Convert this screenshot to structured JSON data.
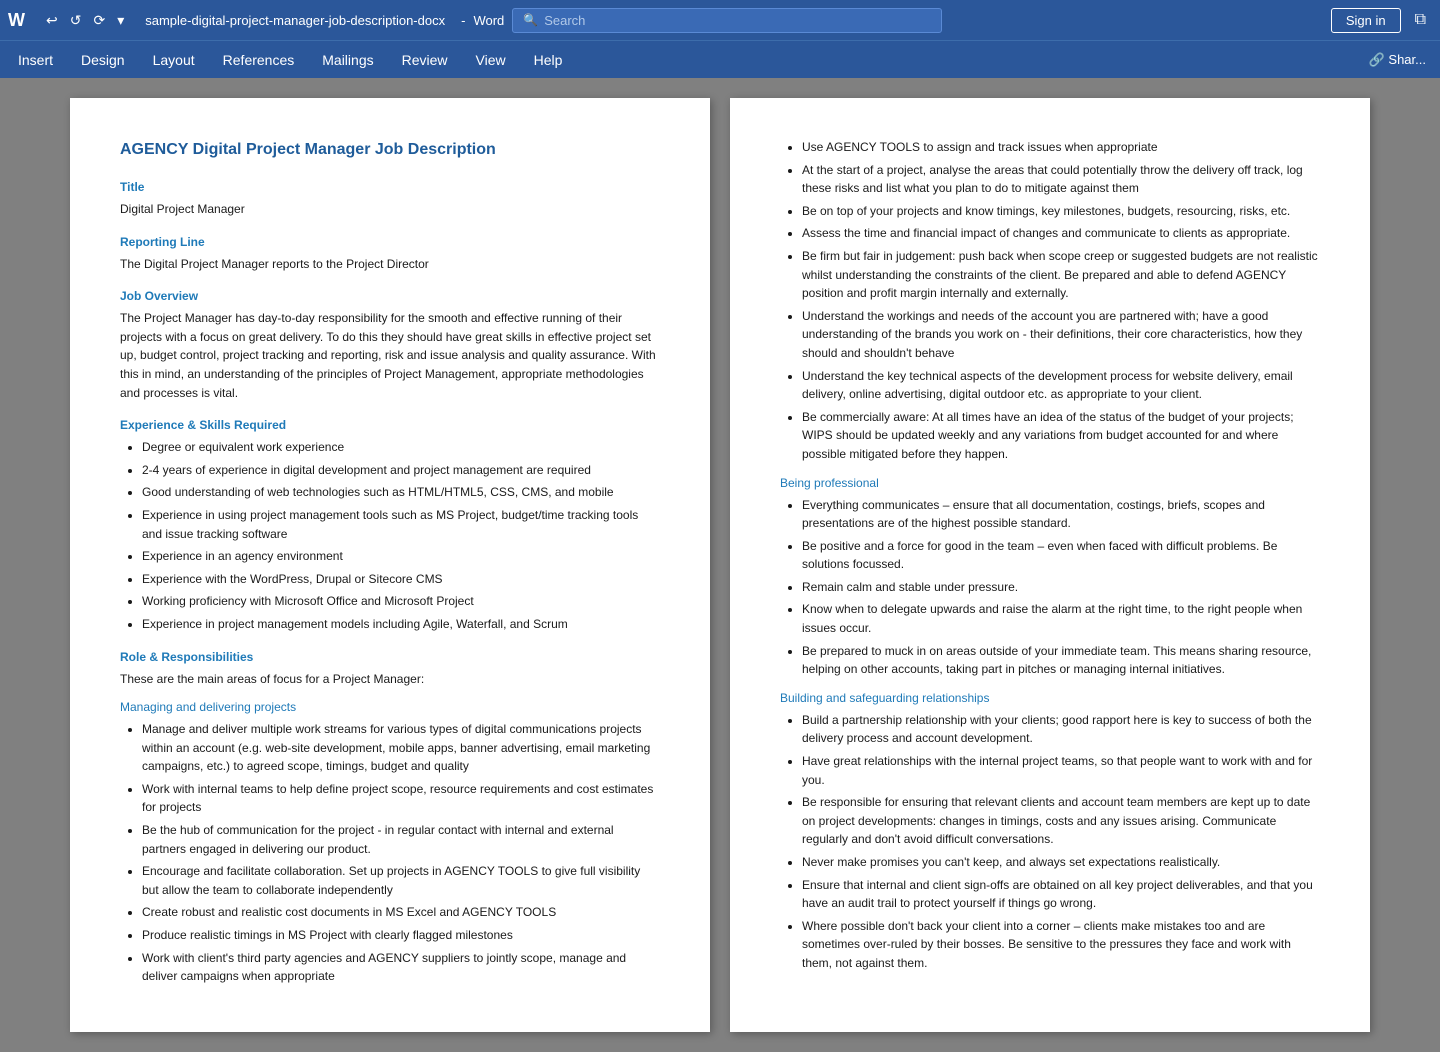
{
  "titlebar": {
    "filename": "sample-digital-project-manager-job-description-docx",
    "separator": " - ",
    "app_name": "Word",
    "search_placeholder": "Search",
    "signin_label": "Sign in",
    "undo_icon": "↩",
    "redo_icon": "↺",
    "autosave_icon": "⟳",
    "quick_access_icon": "▾",
    "restore_icon": "⧉"
  },
  "menubar": {
    "items": [
      "Insert",
      "Design",
      "Layout",
      "References",
      "Mailings",
      "Review",
      "View",
      "Help"
    ],
    "share_label": "🔗 Shar..."
  },
  "page_left": {
    "doc_title": "AGENCY Digital Project Manager Job Description",
    "sections": [
      {
        "heading": "Title",
        "body": "Digital Project Manager"
      },
      {
        "heading": "Reporting Line",
        "body": "The Digital Project Manager reports to the Project Director"
      },
      {
        "heading": "Job Overview",
        "body": "The Project Manager has day-to-day responsibility for the smooth and effective running of their projects with a focus on great delivery. To do this they should have great skills in effective project set up, budget control, project tracking and reporting, risk and issue analysis and quality assurance. With this in mind, an understanding of the principles of Project Management, appropriate methodologies and processes is vital."
      },
      {
        "heading": "Experience & Skills Required",
        "list": [
          "Degree or equivalent work experience",
          "2-4 years of experience in digital development and project management are required",
          "Good understanding of web technologies such as HTML/HTML5, CSS, CMS, and mobile",
          "Experience in using project management tools such as MS Project, budget/time tracking tools and issue tracking software",
          "Experience in an agency environment",
          "Experience with the WordPress, Drupal or Sitecore CMS",
          "Working proficiency with Microsoft Office and Microsoft Project",
          "Experience in project management models including Agile, Waterfall, and Scrum"
        ]
      },
      {
        "heading": "Role & Responsibilities",
        "body": "These are the main areas of focus for a Project Manager:"
      },
      {
        "subheading": "Managing and delivering projects",
        "list": [
          "Manage and deliver multiple work streams for various types of digital communications projects within an account (e.g. web-site development, mobile apps, banner advertising, email marketing campaigns, etc.) to agreed scope, timings, budget and quality",
          "Work with internal teams to help define project scope, resource requirements and cost estimates for projects",
          "Be the hub of communication for the project - in regular contact with internal and external partners engaged in delivering our product.",
          "Encourage and facilitate collaboration. Set up projects in AGENCY TOOLS to give full visibility but allow the team to collaborate independently",
          "Create robust and realistic cost documents in MS Excel and AGENCY TOOLS",
          "Produce realistic timings in MS Project with clearly flagged milestones",
          "Work with client's third party agencies and AGENCY suppliers to jointly scope, manage and deliver campaigns when appropriate"
        ]
      }
    ]
  },
  "page_right": {
    "sections": [
      {
        "list": [
          "Use AGENCY TOOLS to assign and track issues when appropriate",
          "At the start of a project, analyse the areas that could potentially throw the delivery off track, log these risks and list what you plan to do to mitigate against them",
          "Be on top of your projects and know timings, key milestones, budgets, resourcing, risks, etc.",
          "Assess the time and financial impact of changes and communicate to clients as appropriate.",
          "Be firm but fair in judgement: push back when scope creep or suggested budgets are not realistic whilst understanding the constraints of the client. Be prepared and able to defend AGENCY position and profit margin internally and externally.",
          "Understand the workings and needs of the account you are partnered with; have a good understanding of the brands you work on - their definitions, their core characteristics, how they should and shouldn't behave",
          "Understand the key technical aspects of the development process for website delivery, email delivery, online advertising, digital outdoor etc. as appropriate to your client.",
          "Be commercially aware: At all times have an idea of the status of the budget of your projects; WIPS should be updated weekly and any variations from budget accounted for and where possible mitigated before they happen."
        ]
      },
      {
        "subheading": "Being professional",
        "list": [
          "Everything communicates – ensure that all documentation, costings, briefs, scopes and presentations are of the highest possible standard.",
          "Be positive and a force for good in the team – even when faced with difficult problems. Be solutions focussed.",
          "Remain calm and stable under pressure.",
          "Know when to delegate upwards and raise the alarm at the right time, to the right people when issues occur.",
          "Be prepared to muck in on areas outside of your immediate team. This means sharing resource, helping on other accounts, taking part in pitches or managing internal initiatives."
        ]
      },
      {
        "subheading": "Building and safeguarding relationships",
        "list": [
          "Build a partnership relationship with your clients; good rapport here is key to success of both the delivery process and account development.",
          "Have great relationships with the internal project teams, so that people want to work with and for you.",
          "Be responsible for ensuring that relevant clients and account team members are kept up to date on project developments: changes in timings, costs and any issues arising. Communicate regularly and don't avoid difficult conversations.",
          "Never make promises you can't keep, and always set expectations realistically.",
          "Ensure that internal and client sign-offs are obtained on all key project deliverables, and that you have an audit trail to protect yourself if things go wrong.",
          "Where possible don't back your client into a corner – clients make mistakes too and are sometimes over-ruled by their bosses. Be sensitive to the pressures they face and work with them, not against them."
        ]
      }
    ]
  }
}
